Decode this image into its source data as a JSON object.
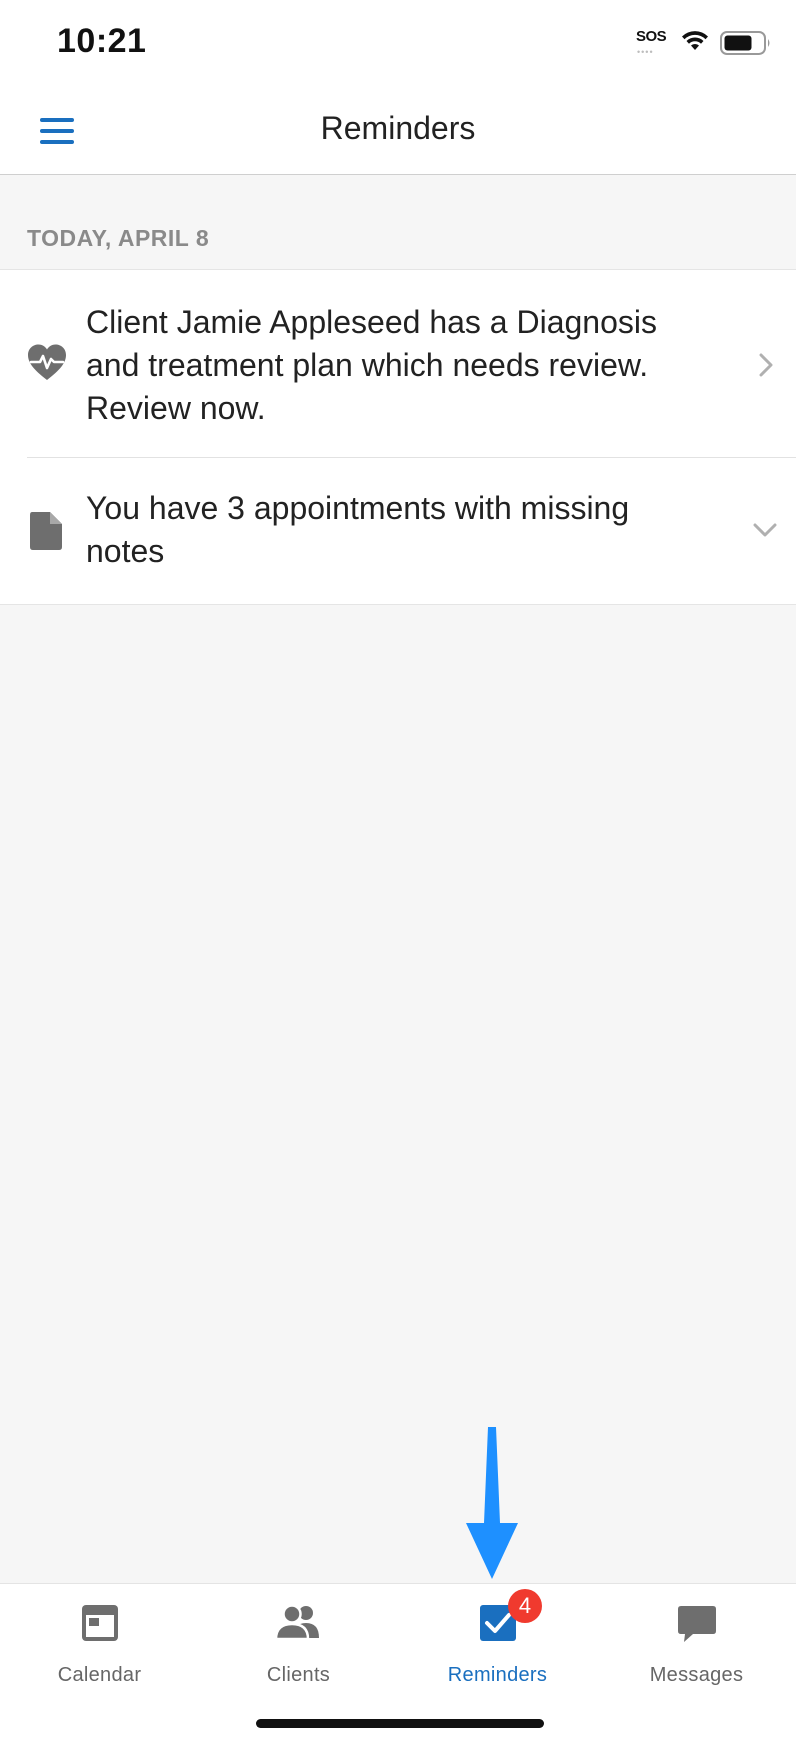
{
  "status_bar": {
    "time": "10:21",
    "sos": "SOS",
    "sos_dots": "••••"
  },
  "header": {
    "title": "Reminders",
    "menu_icon": "hamburger-menu-icon"
  },
  "section": {
    "date_label": "TODAY, APRIL 8"
  },
  "reminders": [
    {
      "icon": "heart-pulse-icon",
      "text": "Client Jamie Appleseed has a Diagnosis and treatment plan which needs review. Review now.",
      "indicator": "chevron-right-icon"
    },
    {
      "icon": "document-icon",
      "text": "You have 3 appointments with missing notes",
      "indicator": "chevron-down-icon"
    }
  ],
  "tabs": [
    {
      "label": "Calendar",
      "icon": "calendar-icon",
      "active": false
    },
    {
      "label": "Clients",
      "icon": "people-icon",
      "active": false
    },
    {
      "label": "Reminders",
      "icon": "checkbox-icon",
      "active": true,
      "badge": "4"
    },
    {
      "label": "Messages",
      "icon": "chat-bubble-icon",
      "active": false
    }
  ],
  "colors": {
    "accent": "#1a6fbf",
    "badge": "#f03a2e",
    "annotation_arrow": "#1e90ff",
    "background": "#f6f6f6"
  }
}
